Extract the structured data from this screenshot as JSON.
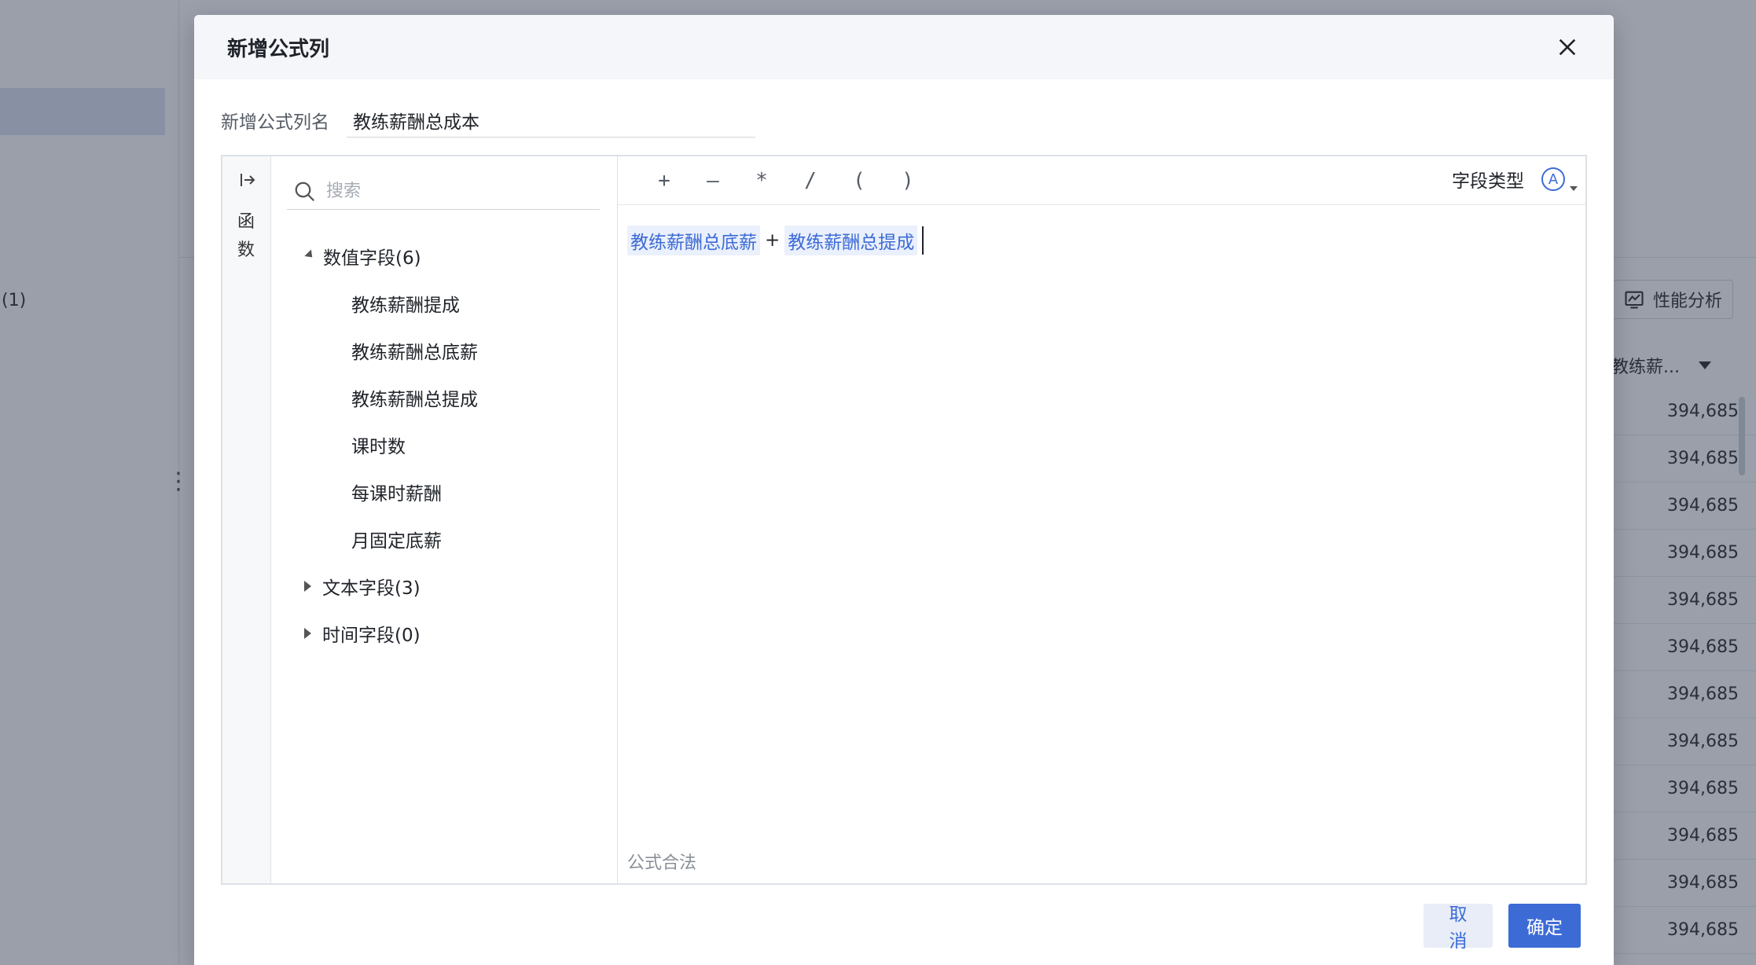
{
  "background": {
    "left_count": "(1)",
    "perf_button": "性能分析",
    "column_header": "教练薪...",
    "rows": [
      "394,685",
      "394,685",
      "394,685",
      "394,685",
      "394,685",
      "394,685",
      "394,685",
      "394,685",
      "394,685",
      "394,685",
      "394,685",
      "394,685"
    ]
  },
  "modal": {
    "title": "新增公式列",
    "name_label": "新增公式列名",
    "name_value": "教练薪酬总成本",
    "fn_label": "函数",
    "search_placeholder": "搜索",
    "groups": [
      {
        "label": "数值字段(6)",
        "expanded": true,
        "items": [
          "教练薪酬提成",
          "教练薪酬总底薪",
          "教练薪酬总提成",
          "课时数",
          "每课时薪酬",
          "月固定底薪"
        ]
      },
      {
        "label": "文本字段(3)",
        "expanded": false
      },
      {
        "label": "时间字段(0)",
        "expanded": false
      }
    ],
    "operators": [
      "+",
      "—",
      "*",
      "/",
      "(",
      ")"
    ],
    "field_type_label": "字段类型",
    "field_type_icon": "A",
    "formula": {
      "token1": "教练薪酬总底薪",
      "op": "+",
      "token2": "教练薪酬总提成"
    },
    "status": "公式合法",
    "cancel_label": "取消",
    "ok_label": "确定",
    "accent_color": "#3d6bd6"
  }
}
